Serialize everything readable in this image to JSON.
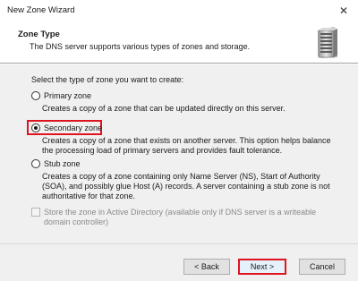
{
  "window": {
    "title": "New Zone Wizard",
    "close_glyph": "✕"
  },
  "header": {
    "title": "Zone Type",
    "subtitle": "The DNS server supports various types of zones and storage.",
    "icon": "server-icon"
  },
  "main": {
    "prompt": "Select the type of zone you want to create:",
    "options": [
      {
        "label": "Primary zone",
        "description": "Creates a copy of a zone that can be updated directly on this server.",
        "selected": false
      },
      {
        "label": "Secondary zone",
        "description": "Creates a copy of a zone that exists on another server. This option helps balance the processing load of primary servers and provides fault tolerance.",
        "selected": true
      },
      {
        "label": "Stub zone",
        "description": "Creates a copy of a zone containing only Name Server (NS), Start of Authority (SOA), and possibly glue Host (A) records. A server containing a stub zone is not authoritative for that zone.",
        "selected": false
      }
    ],
    "store_ad": {
      "label": "Store the zone in Active Directory (available only if DNS server is a writeable domain controller)",
      "checked": false,
      "enabled": false
    }
  },
  "footer": {
    "back_label": "< Back",
    "next_label": "Next >",
    "cancel_label": "Cancel"
  },
  "colors": {
    "highlight": "#e0141e",
    "panel_bg": "#f0f0f0"
  }
}
